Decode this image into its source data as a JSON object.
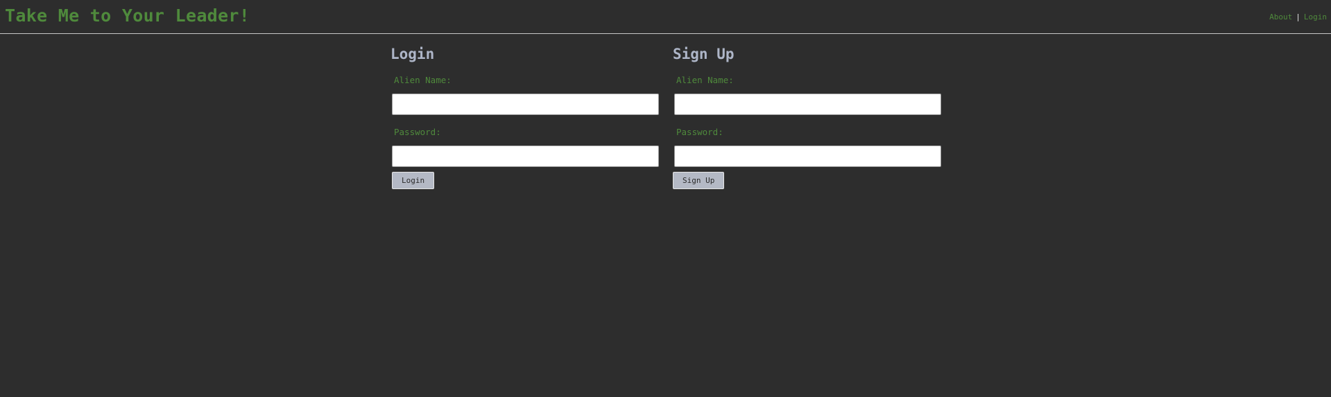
{
  "header": {
    "title": "Take Me to Your Leader!",
    "nav": {
      "about": "About",
      "separator": "|",
      "login": "Login"
    }
  },
  "login_form": {
    "heading": "Login",
    "name_label": "Alien Name:",
    "name_value": "",
    "password_label": "Password:",
    "password_value": "",
    "submit_label": "Login"
  },
  "signup_form": {
    "heading": "Sign Up",
    "name_label": "Alien Name:",
    "name_value": "",
    "password_label": "Password:",
    "password_value": "",
    "submit_label": "Sign Up"
  },
  "colors": {
    "background": "#2d2d2d",
    "accent_green": "#4f8a3c",
    "heading": "#aeb6c8",
    "button": "#b4b9c5"
  }
}
